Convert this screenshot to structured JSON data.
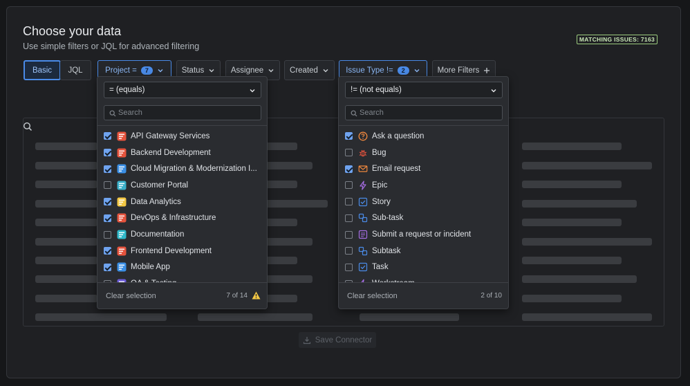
{
  "header": {
    "title": "Choose your data",
    "subtitle": "Use simple filters or JQL for advanced filtering",
    "matching": "MATCHING ISSUES: 7163"
  },
  "toolbar": {
    "basic": "Basic",
    "jql": "JQL",
    "project": {
      "label": "Project =",
      "count": "7"
    },
    "status": "Status",
    "assignee": "Assignee",
    "created": "Created",
    "issue_type": {
      "label": "Issue Type !=",
      "count": "2"
    },
    "more_filters": "More Filters"
  },
  "save_button": "Save Connector",
  "project_dropdown": {
    "operator": "= (equals)",
    "search_placeholder": "Search",
    "items": [
      {
        "label": "API Gateway Services",
        "checked": true,
        "icon": "api-gateway-icon",
        "color": "#e5533d"
      },
      {
        "label": "Backend Development",
        "checked": true,
        "icon": "backend-icon",
        "color": "#e5533d"
      },
      {
        "label": "Cloud Migration & Modernization I...",
        "checked": true,
        "icon": "cloud-icon",
        "color": "#3b8fe5"
      },
      {
        "label": "Customer Portal",
        "checked": false,
        "icon": "portal-icon",
        "color": "#3bb0c9"
      },
      {
        "label": "Data Analytics",
        "checked": true,
        "icon": "analytics-icon",
        "color": "#f2c744"
      },
      {
        "label": "DevOps & Infrastructure",
        "checked": true,
        "icon": "devops-icon",
        "color": "#e5533d"
      },
      {
        "label": "Documentation",
        "checked": false,
        "icon": "docs-icon",
        "color": "#2fb8c9"
      },
      {
        "label": "Frontend Development",
        "checked": true,
        "icon": "frontend-icon",
        "color": "#e5533d"
      },
      {
        "label": "Mobile App",
        "checked": true,
        "icon": "mobile-icon",
        "color": "#3b8fe5"
      },
      {
        "label": "QA & Testing",
        "checked": false,
        "icon": "qa-icon",
        "color": "#6b5ad9"
      }
    ],
    "clear": "Clear selection",
    "count": "7 of 14"
  },
  "issue_dropdown": {
    "operator": "!= (not equals)",
    "search_placeholder": "Search",
    "items": [
      {
        "label": "Ask a question",
        "checked": true,
        "icon": "question-icon",
        "color": "#f0883e"
      },
      {
        "label": "Bug",
        "checked": false,
        "icon": "bug-icon",
        "color": "#e5533d"
      },
      {
        "label": "Email request",
        "checked": true,
        "icon": "email-icon",
        "color": "#f0883e"
      },
      {
        "label": "Epic",
        "checked": false,
        "icon": "epic-icon",
        "color": "#a56de2"
      },
      {
        "label": "Story",
        "checked": false,
        "icon": "story-icon",
        "color": "#4a8be8"
      },
      {
        "label": "Sub-task",
        "checked": false,
        "icon": "subtask-icon",
        "color": "#4a8be8"
      },
      {
        "label": "Submit a request or incident",
        "checked": false,
        "icon": "request-icon",
        "color": "#a56de2"
      },
      {
        "label": "Subtask",
        "checked": false,
        "icon": "subtask-icon",
        "color": "#4a8be8"
      },
      {
        "label": "Task",
        "checked": false,
        "icon": "task-icon",
        "color": "#4a8be8"
      },
      {
        "label": "Workstream",
        "checked": false,
        "icon": "workstream-icon",
        "color": "#a56de2"
      }
    ],
    "clear": "Clear selection",
    "count": "2 of 10"
  }
}
